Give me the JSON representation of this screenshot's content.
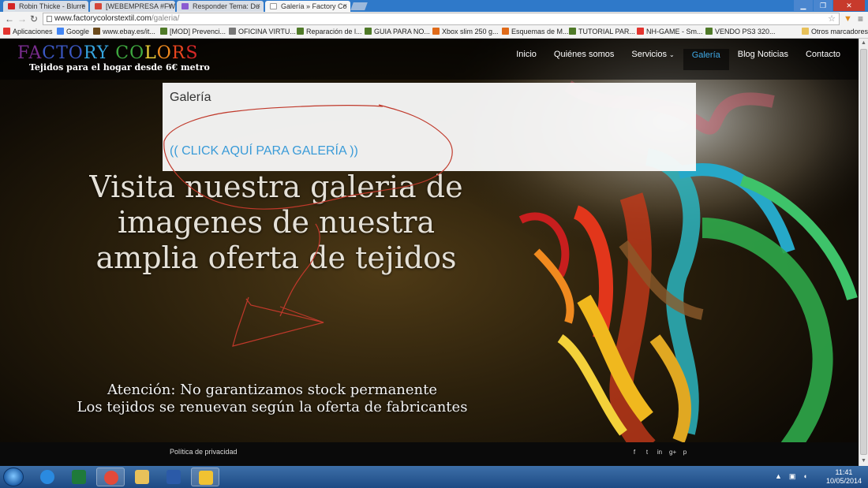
{
  "browser": {
    "tabs": [
      {
        "label": "Robin Thicke - Blurre",
        "close": "×",
        "favicon_color": "#d32424"
      },
      {
        "label": "[WEBEMPRESA #FW",
        "close": "×",
        "favicon_color": "#d44638"
      },
      {
        "label": "Responder Tema: Du",
        "close": "×",
        "favicon_color": "#8a5bd1"
      },
      {
        "label": "Galería » Factory Co",
        "close": "×",
        "favicon_color": "#ffffff"
      }
    ],
    "address": {
      "host": "www.factorycolorstextil.com",
      "path": "/galeria/"
    },
    "bookmarks": [
      {
        "label": "Aplicaciones",
        "icon_color": "#e3342f"
      },
      {
        "label": "Google",
        "icon_color": "#4285f4"
      },
      {
        "label": "www.ebay.es/it...",
        "icon_color": "#6b4a1c"
      },
      {
        "label": "[MOD] Prevenci...",
        "icon_color": "#4f7a28"
      },
      {
        "label": "OFICINA VIRTU...",
        "icon_color": "#777777"
      },
      {
        "label": "Reparación de l...",
        "icon_color": "#4f7a28"
      },
      {
        "label": "GUIA PARA NO...",
        "icon_color": "#4f7a28"
      },
      {
        "label": "Xbox slim 250 g...",
        "icon_color": "#e06b1a"
      },
      {
        "label": "Esquemas de M...",
        "icon_color": "#e06b1a"
      },
      {
        "label": "TUTORIAL PAR...",
        "icon_color": "#4f7a28"
      },
      {
        "label": "NH-GAME - Sm...",
        "icon_color": "#e3342f"
      },
      {
        "label": "VENDO PS3 320...",
        "icon_color": "#4f7a28"
      },
      {
        "label": "Otros marcadores",
        "icon_color": "#e8c15a"
      }
    ]
  },
  "site": {
    "logo": {
      "letters": [
        "F",
        "A",
        "C",
        "T",
        "O",
        "R",
        "Y",
        " ",
        "C",
        "O",
        "L",
        "O",
        "R",
        "S"
      ],
      "letter_colors": [
        "#7a2d8f",
        "#7a2d8f",
        "#3b58c4",
        "#3b58c4",
        "#3b58c4",
        "#36a6e0",
        "#36a6e0",
        "#000",
        "#3ea83f",
        "#3ea83f",
        "#f0d23a",
        "#f28b1f",
        "#e8451f",
        "#d62828"
      ],
      "tagline": "Tejidos para el hogar desde 6€ metro"
    },
    "menu": [
      {
        "label": "Inicio"
      },
      {
        "label": "Quiénes somos"
      },
      {
        "label": "Servicios",
        "chevron": "⌄"
      },
      {
        "label": "Galería",
        "active": true
      },
      {
        "label": "Blog Noticias"
      },
      {
        "label": "Contacto"
      }
    ],
    "panel": {
      "title": "Galería",
      "link": "(( CLICK AQUÍ PARA GALERÍA ))"
    },
    "headline": [
      "Visita nuestra galeria de",
      "imagenes de nuestra",
      "amplia oferta de tejidos"
    ],
    "notice": [
      "Atención: No garantizamos stock permanente",
      "Los tejidos se renuevan según la oferta de fabricantes"
    ],
    "footer": {
      "privacy": "Política de privacidad",
      "social": [
        "f",
        "t",
        "in",
        "g+",
        "p"
      ]
    }
  },
  "taskbar": {
    "apps": [
      {
        "name": "internet-explorer",
        "color": "#2a8ae0"
      },
      {
        "name": "excel",
        "color": "#1f7a3a"
      },
      {
        "name": "chrome",
        "color": "#e24a3a"
      },
      {
        "name": "explorer",
        "color": "#e8c15a"
      },
      {
        "name": "word",
        "color": "#2b5aa8"
      },
      {
        "name": "security",
        "color": "#f1c232"
      }
    ],
    "time": "11:41",
    "date": "10/05/2014"
  }
}
